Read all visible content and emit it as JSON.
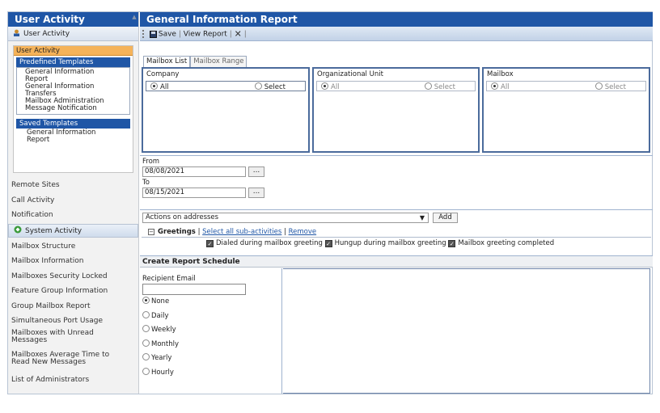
{
  "sidebar": {
    "title": "User Activity",
    "user_activity_link": "User Activity",
    "templates_box": {
      "header": "User Activity",
      "predefined_title": "Predefined Templates",
      "predefined_items": [
        "General Information Report",
        "General Information Transfers",
        "Mailbox Administration Message Notification"
      ],
      "saved_title": "Saved Templates",
      "saved_items": [
        "General Information Report"
      ]
    },
    "items_a": [
      "Remote Sites",
      "Call Activity",
      "Notification"
    ],
    "system_activity": "System Activity",
    "items_b": [
      "Mailbox Structure",
      "Mailbox Information",
      "Mailboxes Security Locked",
      "Feature Group Information",
      "Group Mailbox Report",
      "Simultaneous Port Usage",
      "Mailboxes with Unread Messages",
      "Mailboxes Average Time to Read New Messages",
      "List of Administrators"
    ]
  },
  "main": {
    "title": "General Information Report",
    "toolbar": {
      "save": "Save",
      "sep1": "|",
      "view": "View Report",
      "sep2": "|",
      "close": "✕",
      "sep3": "|"
    },
    "tabs": [
      "Mailbox List",
      "Mailbox Range"
    ],
    "filters": [
      {
        "title": "Company",
        "opt_all": "All",
        "opt_select": "Select"
      },
      {
        "title": "Organizational Unit",
        "opt_all": "All",
        "opt_select": "Select"
      },
      {
        "title": "Mailbox",
        "opt_all": "All",
        "opt_select": "Select"
      }
    ],
    "dates": {
      "from_label": "From",
      "from_value": "08/08/2021",
      "to_label": "To",
      "to_value": "08/15/2021",
      "picker": "..."
    },
    "actions": {
      "select_value": "Actions on addresses",
      "add": "Add",
      "group_title": "Greetings",
      "select_all": "Select all sub-activities",
      "pipe": "|",
      "remove": "Remove",
      "checks": [
        "Dialed during mailbox greeting",
        "Hungup during mailbox greeting",
        "Mailbox greeting completed"
      ]
    },
    "schedule": {
      "title": "Create Report Schedule",
      "email_label": "Recipient Email",
      "email_value": "",
      "frequencies": [
        "None",
        "Daily",
        "Weekly",
        "Monthly",
        "Yearly",
        "Hourly"
      ],
      "selected": "None"
    }
  },
  "colors": {
    "header_blue": "#1f56a6",
    "orange": "#f5b35a",
    "border_blue": "#4b6b9c"
  }
}
